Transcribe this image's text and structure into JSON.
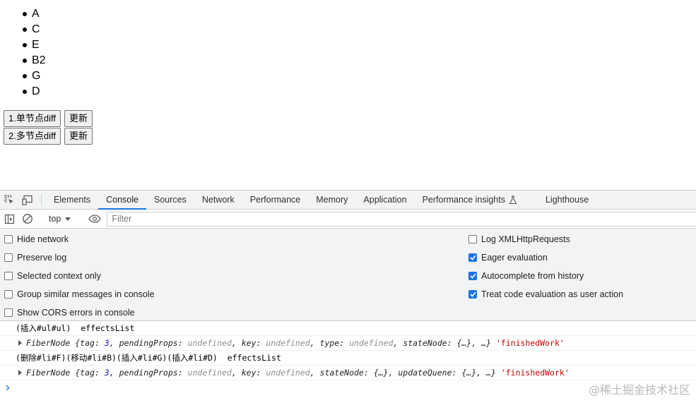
{
  "page": {
    "list": [
      "A",
      "C",
      "E",
      "B2",
      "G",
      "D"
    ],
    "row1": {
      "diff_button": "1.单节点diff",
      "update_button": "更新"
    },
    "row2": {
      "diff_button": "2.多节点diff",
      "update_button": "更新"
    }
  },
  "devtools": {
    "tabs": [
      "Elements",
      "Console",
      "Sources",
      "Network",
      "Performance",
      "Memory",
      "Application",
      "Performance insights",
      "Lighthouse"
    ],
    "active_tab": "Console",
    "context": "top",
    "filter_placeholder": "Filter",
    "settings_left": [
      {
        "label": "Hide network",
        "checked": false
      },
      {
        "label": "Preserve log",
        "checked": false
      },
      {
        "label": "Selected context only",
        "checked": false
      },
      {
        "label": "Group similar messages in console",
        "checked": false
      },
      {
        "label": "Show CORS errors in console",
        "checked": false
      }
    ],
    "settings_right": [
      {
        "label": "Log XMLHttpRequests",
        "checked": false
      },
      {
        "label": "Eager evaluation",
        "checked": true
      },
      {
        "label": "Autocomplete from history",
        "checked": true
      },
      {
        "label": "Treat code evaluation as user action",
        "checked": true
      }
    ],
    "console": {
      "log1": "(插入#ul#ul)  effectsList",
      "obj1": {
        "name": "FiberNode",
        "tag_val": "3",
        "k1": "pendingProps",
        "k2": "key",
        "k3": "type",
        "k4": "stateNode",
        "undef": "undefined",
        "ellipsis": "{…}",
        "tail": "…}",
        "str": "'finishedWork'"
      },
      "log2": "(删除#li#F)(移动#li#B)(插入#li#G)(插入#li#D)  effectsList",
      "obj2": {
        "name": "FiberNode",
        "tag_val": "3",
        "k1": "pendingProps",
        "k2": "key",
        "k3": "stateNode",
        "k4": "updateQuene",
        "undef": "undefined",
        "ellipsis": "{…}",
        "tail": "…}",
        "str": "'finishedWork'"
      }
    }
  },
  "watermark": "@稀土掘金技术社区",
  "colors": {
    "accent": "#1a73e8",
    "string": "#c80000",
    "number": "#1a1aa6"
  },
  "icons": [
    "inspect-icon",
    "device-toggle-icon",
    "sidebar-icon",
    "clear-icon",
    "eye-icon",
    "flask-icon",
    "chevron-down-icon",
    "expand-triangle-icon",
    "prompt-icon"
  ]
}
